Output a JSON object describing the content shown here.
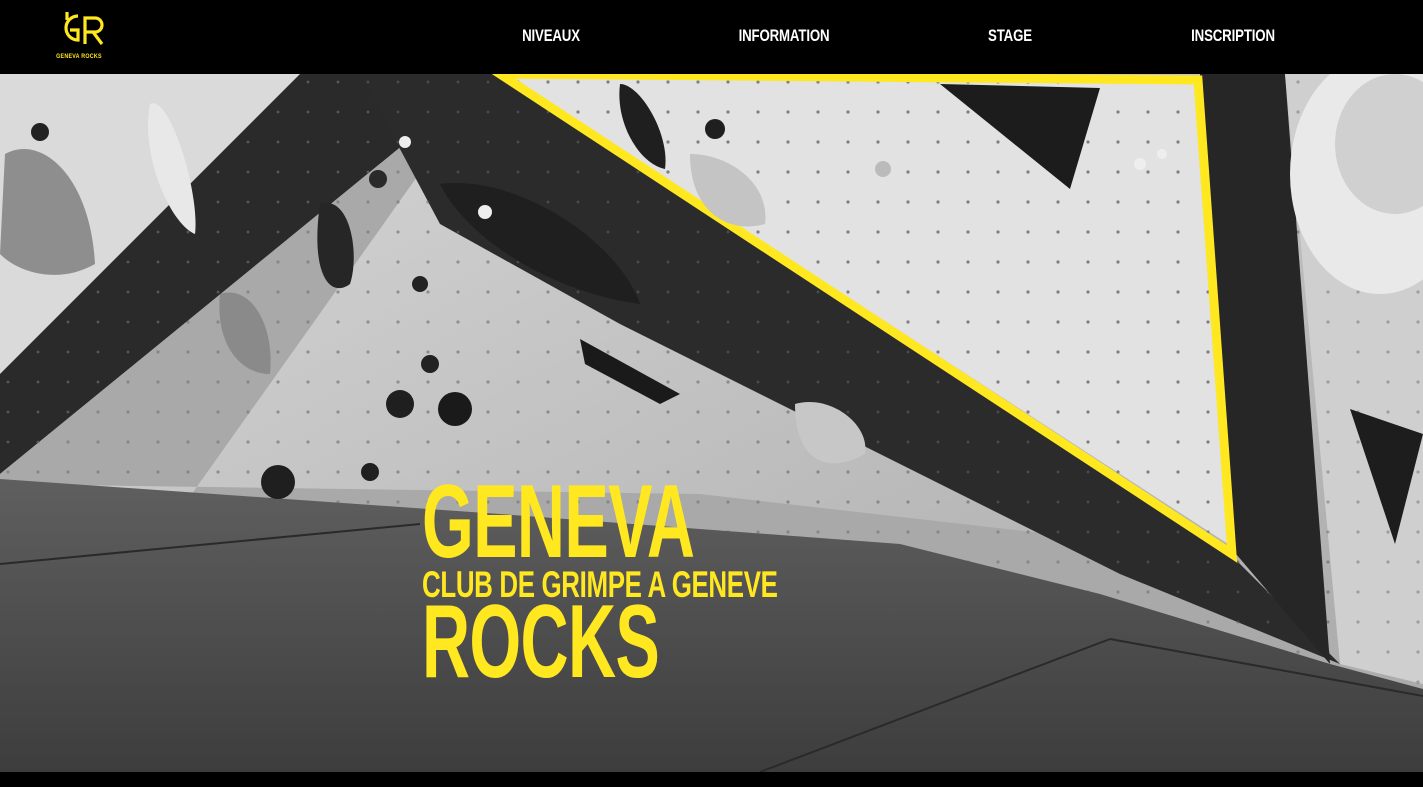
{
  "brand": {
    "logo_letters": "GR",
    "logo_text": "GENEVA ROCKS",
    "accent_color": "#ffe81f"
  },
  "nav": {
    "items": [
      {
        "label": "NIVEAUX"
      },
      {
        "label": "INFORMATION"
      },
      {
        "label": "STAGE"
      },
      {
        "label": "INSCRIPTION"
      }
    ]
  },
  "hero": {
    "title_line1": "GENEVA",
    "subtitle": "CLUB DE GRIMPE A GENEVE",
    "title_line2": "ROCKS",
    "background_description_icon": "climbing-wall-photo"
  }
}
